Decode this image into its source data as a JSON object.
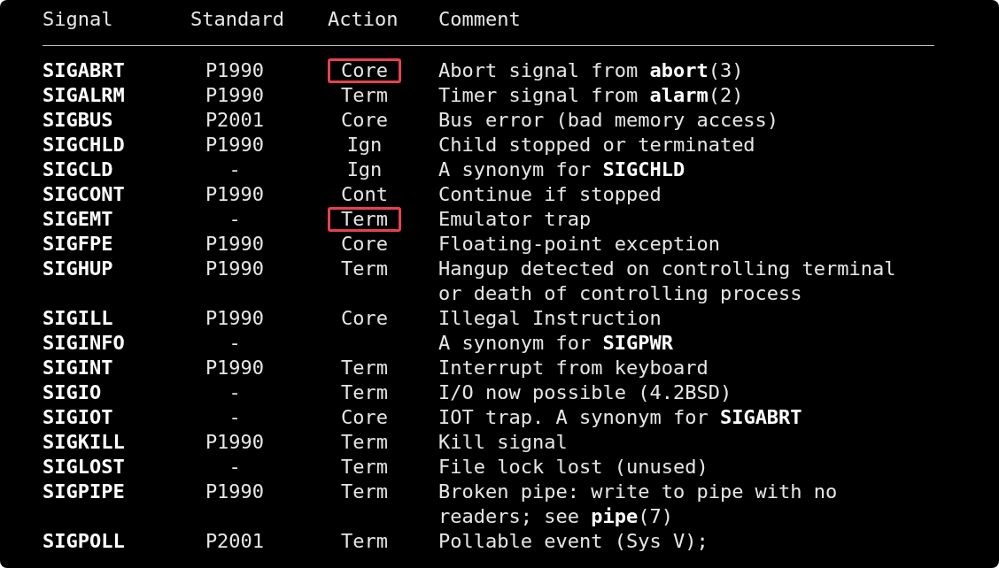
{
  "header": {
    "columns": [
      "Signal",
      "Standard",
      "Action",
      "Comment"
    ]
  },
  "rows": [
    {
      "signal": "SIGABRT",
      "standard": "P1990",
      "action": "Core",
      "highlighted": true,
      "comment": [
        "Abort signal from **abort**(3)"
      ]
    },
    {
      "signal": "SIGALRM",
      "standard": "P1990",
      "action": "Term",
      "highlighted": false,
      "comment": [
        "Timer signal from **alarm**(2)"
      ]
    },
    {
      "signal": "SIGBUS",
      "standard": "P2001",
      "action": "Core",
      "highlighted": false,
      "comment": [
        "Bus error (bad memory access)"
      ]
    },
    {
      "signal": "SIGCHLD",
      "standard": "P1990",
      "action": "Ign",
      "highlighted": false,
      "comment": [
        "Child stopped or terminated"
      ]
    },
    {
      "signal": "SIGCLD",
      "standard": "-",
      "action": "Ign",
      "highlighted": false,
      "comment": [
        "A synonym for **SIGCHLD**"
      ]
    },
    {
      "signal": "SIGCONT",
      "standard": "P1990",
      "action": "Cont",
      "highlighted": false,
      "comment": [
        "Continue if stopped"
      ]
    },
    {
      "signal": "SIGEMT",
      "standard": "-",
      "action": "Term",
      "highlighted": true,
      "comment": [
        "Emulator trap"
      ]
    },
    {
      "signal": "SIGFPE",
      "standard": "P1990",
      "action": "Core",
      "highlighted": false,
      "comment": [
        "Floating-point exception"
      ]
    },
    {
      "signal": "SIGHUP",
      "standard": "P1990",
      "action": "Term",
      "highlighted": false,
      "comment": [
        "Hangup detected on controlling terminal",
        "or death of controlling process"
      ]
    },
    {
      "signal": "SIGILL",
      "standard": "P1990",
      "action": "Core",
      "highlighted": false,
      "comment": [
        "Illegal Instruction"
      ]
    },
    {
      "signal": "SIGINFO",
      "standard": "-",
      "highlighted": false,
      "comment": [
        "A synonym for **SIGPWR**"
      ]
    },
    {
      "signal": "SIGINT",
      "standard": "P1990",
      "action": "Term",
      "highlighted": false,
      "comment": [
        "Interrupt from keyboard"
      ]
    },
    {
      "signal": "SIGIO",
      "standard": "-",
      "action": "Term",
      "highlighted": false,
      "comment": [
        "I/O now possible (4.2BSD)"
      ]
    },
    {
      "signal": "SIGIOT",
      "standard": "-",
      "action": "Core",
      "highlighted": false,
      "comment": [
        "IOT trap. A synonym for **SIGABRT**"
      ]
    },
    {
      "signal": "SIGKILL",
      "standard": "P1990",
      "action": "Term",
      "highlighted": false,
      "comment": [
        "Kill signal"
      ]
    },
    {
      "signal": "SIGLOST",
      "standard": "-",
      "action": "Term",
      "highlighted": false,
      "comment": [
        "File lock lost (unused)"
      ]
    },
    {
      "signal": "SIGPIPE",
      "standard": "P1990",
      "action": "Term",
      "highlighted": false,
      "comment": [
        "Broken pipe: write to pipe with no",
        "readers; see **pipe**(7)"
      ]
    },
    {
      "signal": "SIGPOLL",
      "standard": "P2001",
      "action": "Term",
      "highlighted": false,
      "comment": [
        "Pollable event (Sys V);"
      ]
    }
  ]
}
